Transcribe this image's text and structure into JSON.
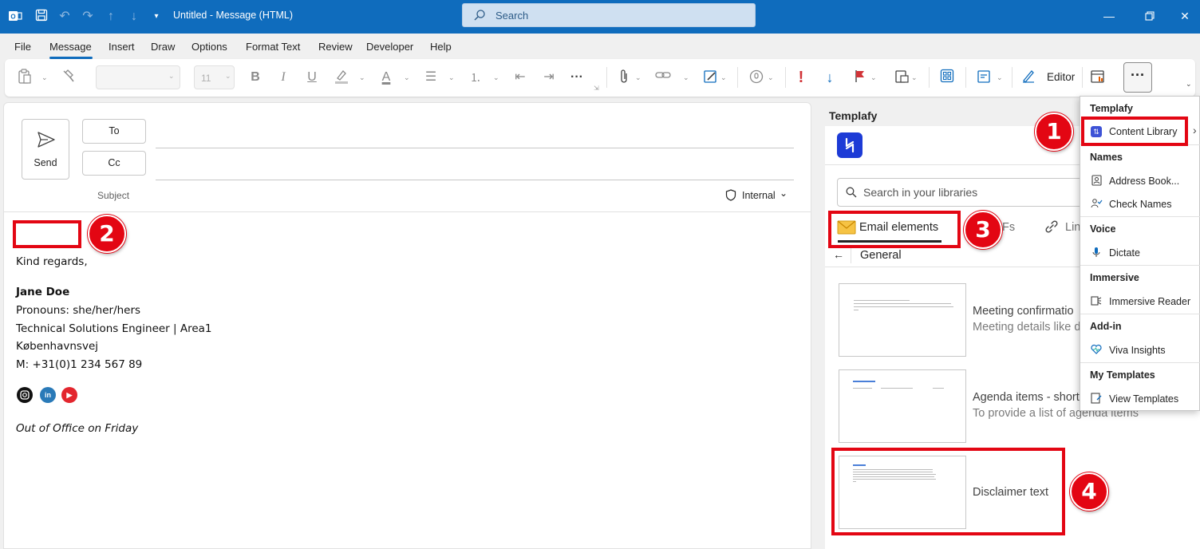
{
  "app": {
    "title": "Untitled  -  Message (HTML)",
    "search_label": "Search"
  },
  "menu": {
    "tabs": [
      "File",
      "Message",
      "Insert",
      "Draw",
      "Options",
      "Format Text",
      "Review",
      "Developer",
      "Help"
    ],
    "active": "Message"
  },
  "ribbon": {
    "font_size": "11",
    "editor_label": "Editor"
  },
  "compose": {
    "send_label": "Send",
    "to_label": "To",
    "cc_label": "Cc",
    "subject_label": "Subject",
    "sensitivity_label": "Internal",
    "body": {
      "closing": "Kind regards,",
      "name": "Jane Doe",
      "pronouns": "Pronouns: she/her/hers",
      "role": "Technical Solutions Engineer | Area1",
      "street": "Københavnsvej",
      "phone": "M: +31(0)1 234 567 89",
      "oof": "Out of Office on Friday"
    },
    "social_icons": [
      "instagram-icon",
      "linkedin-icon",
      "youtube-icon"
    ]
  },
  "templafy": {
    "title": "Templafy",
    "search_placeholder": "Search in your libraries",
    "tabs": [
      "Email elements",
      "PDFs",
      "Lin"
    ],
    "tab_partial": "Fs",
    "breadcrumb": "General",
    "cards": [
      {
        "title": "Meeting confirmatio",
        "desc": "Meeting details like d"
      },
      {
        "title": "Agenda items - short",
        "desc": "To provide a list of agenda items"
      },
      {
        "title": "Disclaimer text",
        "desc": ""
      }
    ]
  },
  "dropdown": {
    "sections": [
      {
        "header": "Templafy",
        "items": [
          {
            "label": "Content Library",
            "icon": "templafy-icon"
          }
        ]
      },
      {
        "header": "Names",
        "items": [
          {
            "label": "Address Book...",
            "icon": "address-book-icon"
          },
          {
            "label": "Check Names",
            "icon": "check-names-icon"
          }
        ]
      },
      {
        "header": "Voice",
        "items": [
          {
            "label": "Dictate",
            "icon": "microphone-icon"
          }
        ]
      },
      {
        "header": "Immersive",
        "items": [
          {
            "label": "Immersive Reader",
            "icon": "immersive-reader-icon"
          }
        ]
      },
      {
        "header": "Add-in",
        "items": [
          {
            "label": "Viva Insights",
            "icon": "viva-insights-icon"
          }
        ]
      },
      {
        "header": "My Templates",
        "items": [
          {
            "label": "View Templates",
            "icon": "view-templates-icon"
          }
        ]
      }
    ]
  },
  "callouts": [
    "1",
    "2",
    "3",
    "4"
  ],
  "colors": {
    "accent": "#0f6cbd",
    "callout": "#e30613",
    "templafy": "#1d3bd6"
  }
}
